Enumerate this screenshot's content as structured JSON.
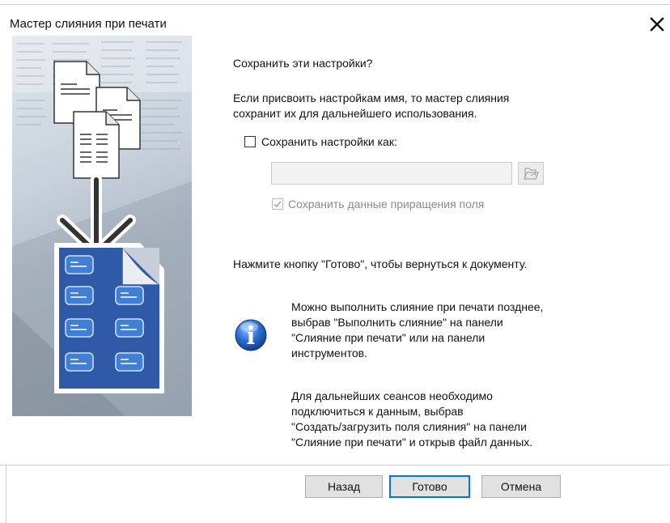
{
  "window": {
    "title": "Мастер слияния при печати"
  },
  "page": {
    "question": "Сохранить эти настройки?",
    "description": "Если присвоить настройкам имя, то мастер слияния\nсохранит их для дальнейшего использования.",
    "save_settings_checkbox": {
      "label": "Сохранить настройки как:",
      "checked": false
    },
    "settings_name_input": {
      "value": ""
    },
    "save_increment_checkbox": {
      "label": "Сохранить данные приращения поля",
      "checked": true,
      "enabled": false
    },
    "press_finish": "Нажмите кнопку \"Готово\", чтобы вернуться к документу.",
    "info_text_1": "Можно выполнить слияние при печати позднее,\nвыбрав \"Выполнить слияние\" на панели\n\"Слияние при печати\" или на панели\nинструментов.",
    "info_text_2": "Для дальнейших сеансов необходимо\nподключиться к данным, выбрав\n\"Создать/загрузить поля слияния\" на панели\n\"Слияние при печати\" и открыв  файл данных."
  },
  "buttons": {
    "back": "Назад",
    "finish": "Готово",
    "cancel": "Отмена"
  },
  "icons": {
    "close": "close-icon",
    "browse": "folder-open-icon",
    "info": "info-icon"
  },
  "colors": {
    "accent": "#0078d7",
    "info_blue": "#1f5fbf",
    "doc_blue": "#2f5aa8"
  }
}
